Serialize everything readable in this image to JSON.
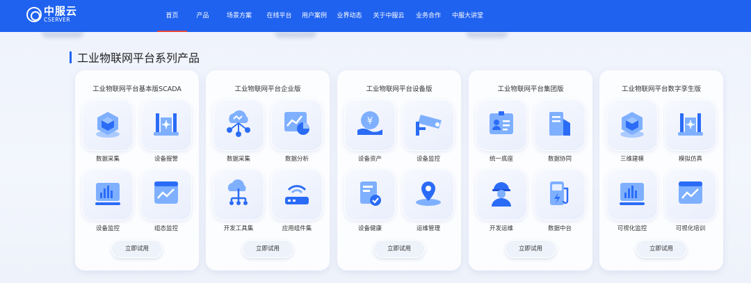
{
  "header": {
    "logo_cn": "中服云",
    "logo_en": "CSERVER",
    "nav": [
      "首页",
      "产品",
      "场景方案",
      "在线平台",
      "用户案例",
      "业界动态",
      "关于中服云",
      "业务合作",
      "中服大讲堂"
    ]
  },
  "section_title": "工业物联网平台系列产品",
  "try_label": "立即试用",
  "colors": {
    "brand": "#1f62f0",
    "active_underline": "#e8463a"
  },
  "cards": [
    {
      "title": "工业物联网平台基本版SCADA",
      "items": [
        {
          "label": "数据采集",
          "icon": "cube-icon"
        },
        {
          "label": "设备报警",
          "icon": "factory-icon"
        },
        {
          "label": "设备监控",
          "icon": "bar-chart-icon"
        },
        {
          "label": "组态监控",
          "icon": "line-chart-window-icon"
        }
      ]
    },
    {
      "title": "工业物联网平台企业版",
      "items": [
        {
          "label": "数据采集",
          "icon": "cloud-network-icon"
        },
        {
          "label": "数据分析",
          "icon": "chart-analysis-icon"
        },
        {
          "label": "开发工具集",
          "icon": "cloud-tree-icon"
        },
        {
          "label": "应用组件集",
          "icon": "router-icon"
        }
      ]
    },
    {
      "title": "工业物联网平台设备版",
      "items": [
        {
          "label": "设备资产",
          "icon": "money-hand-icon"
        },
        {
          "label": "设备监控",
          "icon": "camera-icon"
        },
        {
          "label": "设备健康",
          "icon": "health-doc-icon"
        },
        {
          "label": "运维管理",
          "icon": "location-pin-icon"
        }
      ]
    },
    {
      "title": "工业物联网平台集团版",
      "items": [
        {
          "label": "统一底座",
          "icon": "id-card-icon"
        },
        {
          "label": "数据协同",
          "icon": "building-icon"
        },
        {
          "label": "开发运维",
          "icon": "worker-icon"
        },
        {
          "label": "数据中台",
          "icon": "charging-station-icon"
        }
      ]
    },
    {
      "title": "工业物联网平台数字孪生版",
      "items": [
        {
          "label": "三维建模",
          "icon": "cube-icon"
        },
        {
          "label": "模拟仿真",
          "icon": "factory-icon"
        },
        {
          "label": "可视化监控",
          "icon": "bar-chart-icon"
        },
        {
          "label": "可视化培训",
          "icon": "line-chart-window-icon"
        }
      ]
    }
  ]
}
